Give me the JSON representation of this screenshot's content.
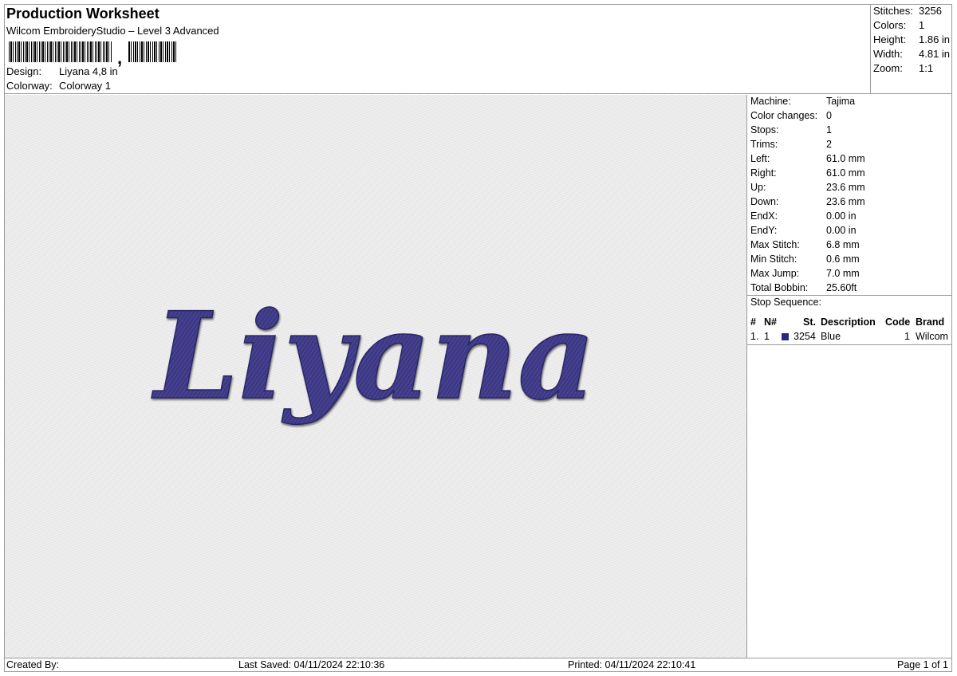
{
  "header": {
    "title": "Production Worksheet",
    "subtitle": "Wilcom EmbroideryStudio – Level 3 Advanced",
    "barcode_separator": ",",
    "design_label": "Design:",
    "design_value": "Liyana 4,8 in",
    "colorway_label": "Colorway:",
    "colorway_value": "Colorway 1"
  },
  "summary": [
    {
      "label": "Stitches:",
      "value": "3256"
    },
    {
      "label": "Colors:",
      "value": "1"
    },
    {
      "label": "Height:",
      "value": "1.86 in"
    },
    {
      "label": "Width:",
      "value": "4.81 in"
    },
    {
      "label": "Zoom:",
      "value": "1:1"
    }
  ],
  "design": {
    "text": "Liyana",
    "thread_color": "#3d3783",
    "background_color": "#ececec"
  },
  "details": [
    {
      "label": "Machine:",
      "value": "Tajima"
    },
    {
      "label": "Color changes:",
      "value": "0"
    },
    {
      "label": "Stops:",
      "value": "1"
    },
    {
      "label": "Trims:",
      "value": "2"
    },
    {
      "label": "Left:",
      "value": "61.0 mm"
    },
    {
      "label": "Right:",
      "value": "61.0 mm"
    },
    {
      "label": "Up:",
      "value": "23.6 mm"
    },
    {
      "label": "Down:",
      "value": "23.6 mm"
    },
    {
      "label": "EndX:",
      "value": "0.00 in"
    },
    {
      "label": "EndY:",
      "value": "0.00 in"
    },
    {
      "label": "Max Stitch:",
      "value": "6.8 mm"
    },
    {
      "label": "Min Stitch:",
      "value": "0.6 mm"
    },
    {
      "label": "Max Jump:",
      "value": "7.0 mm"
    },
    {
      "label": "Total Bobbin:",
      "value": "25.60ft"
    }
  ],
  "stop_sequence": {
    "title": "Stop Sequence:",
    "columns": [
      "#",
      "N#",
      "St.",
      "Description",
      "Code",
      "Brand"
    ],
    "rows": [
      {
        "index": "1.",
        "needle": "1",
        "swatch_color": "#2a2680",
        "stitches": "3254",
        "description": "Blue",
        "code": "1",
        "brand": "Wilcom"
      }
    ]
  },
  "footer": {
    "created_by": "Created By:",
    "last_saved": "Last Saved: 04/11/2024 22:10:36",
    "printed": "Printed: 04/11/2024 22:10:41",
    "page": "Page 1 of 1"
  }
}
